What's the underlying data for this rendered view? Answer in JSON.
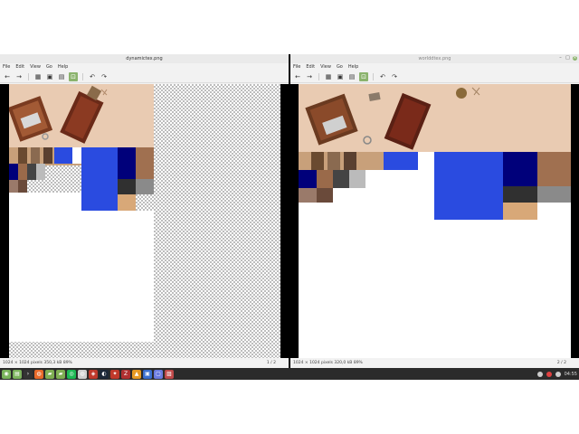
{
  "left_window": {
    "title": "dynamictex.png",
    "menu": [
      "File",
      "Edit",
      "View",
      "Go",
      "Help"
    ],
    "status_info": "1024 × 1024 pixels  350,3 kB  89%",
    "page": "1 / 2"
  },
  "right_window": {
    "title": "worlddtex.png",
    "menu": [
      "File",
      "Edit",
      "View",
      "Go",
      "Help"
    ],
    "status_info": "1024 × 1024 pixels  320,0 kB  89%",
    "page": "2 / 2"
  },
  "toolbar_icons": [
    "arrow-left-icon",
    "arrow-right-icon",
    "separator",
    "thumbnail-icon",
    "gallery-icon",
    "grid-icon",
    "fit-icon",
    "separator",
    "rotate-left-icon",
    "rotate-right-icon"
  ],
  "taskbar": {
    "clock": "04:55",
    "apps": [
      {
        "name": "menu-icon",
        "color": "#78b35a",
        "glyph": "◉"
      },
      {
        "name": "files-icon",
        "color": "#7bb35c",
        "glyph": "▤"
      },
      {
        "name": "terminal-icon",
        "color": "#333333",
        "glyph": "›"
      },
      {
        "name": "firefox-icon",
        "color": "#e86a2a",
        "glyph": "◍"
      },
      {
        "name": "folder-icon",
        "color": "#7eae52",
        "glyph": "▰"
      },
      {
        "name": "folder2-icon",
        "color": "#7eae52",
        "glyph": "▰"
      },
      {
        "name": "spotify-icon",
        "color": "#1db954",
        "glyph": "◎"
      },
      {
        "name": "app-icon",
        "color": "#d0d0d0",
        "glyph": "◍"
      },
      {
        "name": "app2-icon",
        "color": "#c0392b",
        "glyph": "◈"
      },
      {
        "name": "steam-icon",
        "color": "#1b2838",
        "glyph": "◐"
      },
      {
        "name": "app3-icon",
        "color": "#c0392b",
        "glyph": "✦"
      },
      {
        "name": "filezilla-icon",
        "color": "#b03030",
        "glyph": "Z"
      },
      {
        "name": "vlc-icon",
        "color": "#e89a23",
        "glyph": "▲"
      },
      {
        "name": "app4-icon",
        "color": "#3a6fd0",
        "glyph": "▣"
      },
      {
        "name": "app5-icon",
        "color": "#6a7be0",
        "glyph": "▢"
      },
      {
        "name": "image-viewer-icon",
        "color": "#c04a4a",
        "glyph": "▨"
      }
    ]
  }
}
